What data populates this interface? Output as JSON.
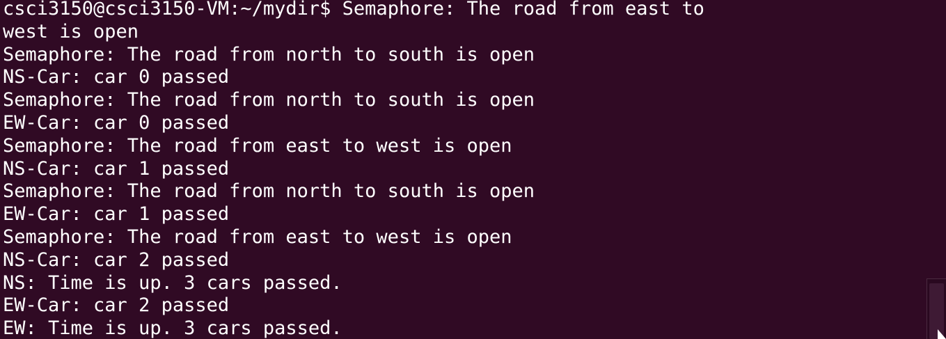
{
  "terminal": {
    "background_color": "#300a24",
    "text_color": "#ffffff",
    "prompt": "csci3150@csci3150-VM:~/mydir$ ",
    "lines": [
      "Semaphore: The road from east to",
      "west is open",
      "Semaphore: The road from north to south is open",
      "NS-Car: car 0 passed",
      "Semaphore: The road from north to south is open",
      "EW-Car: car 0 passed",
      "Semaphore: The road from east to west is open",
      "NS-Car: car 1 passed",
      "Semaphore: The road from north to south is open",
      "EW-Car: car 1 passed",
      "Semaphore: The road from east to west is open",
      "NS-Car: car 2 passed",
      "NS: Time is up. 3 cars passed.",
      "EW-Car: car 2 passed",
      "EW: Time is up. 3 cars passed."
    ]
  },
  "icons": {
    "scrollbar": "scrollbar",
    "cursor": "mouse-pointer-icon"
  }
}
